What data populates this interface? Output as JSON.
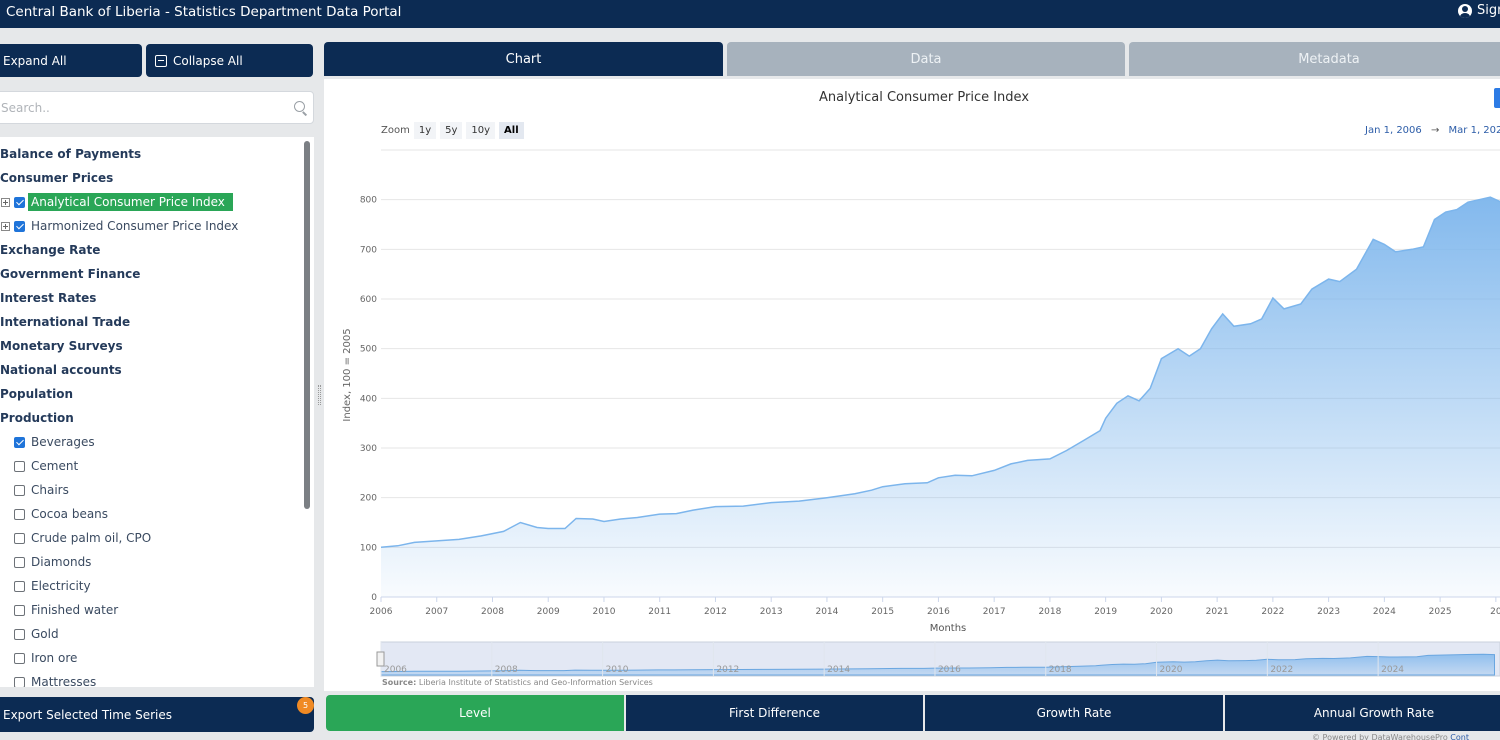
{
  "header": {
    "title": "Central Bank of Liberia - Statistics Department Data Portal",
    "sign_label": "Sign"
  },
  "sidebar": {
    "expand_label": "Expand All",
    "collapse_label": "Collapse All",
    "search_placeholder": "Search..",
    "items": [
      {
        "label": "Balance of Payments"
      },
      {
        "label": "Consumer Prices"
      },
      {
        "label": "Analytical Consumer Price Index"
      },
      {
        "label": "Harmonized Consumer Price Index"
      },
      {
        "label": "Exchange Rate"
      },
      {
        "label": "Government Finance"
      },
      {
        "label": "Interest Rates"
      },
      {
        "label": "International Trade"
      },
      {
        "label": "Monetary Surveys"
      },
      {
        "label": "National accounts"
      },
      {
        "label": "Population"
      },
      {
        "label": "Production"
      },
      {
        "label": "Beverages"
      },
      {
        "label": "Cement"
      },
      {
        "label": "Chairs"
      },
      {
        "label": "Cocoa beans"
      },
      {
        "label": "Crude palm oil, CPO"
      },
      {
        "label": "Diamonds"
      },
      {
        "label": "Electricity"
      },
      {
        "label": "Finished water"
      },
      {
        "label": "Gold"
      },
      {
        "label": "Iron ore"
      },
      {
        "label": "Mattresses"
      }
    ],
    "export_label": "Export Selected Time Series",
    "selected_count": "5"
  },
  "tabs": [
    {
      "label": "Chart"
    },
    {
      "label": "Data"
    },
    {
      "label": "Metadata"
    }
  ],
  "toolbar": {
    "zoom_label": "Zoom",
    "zoom_buttons": [
      {
        "label": "1y"
      },
      {
        "label": "5y"
      },
      {
        "label": "10y"
      },
      {
        "label": "All"
      }
    ],
    "range_from": "Jan 1, 2006",
    "range_arrow": "→",
    "range_to": "Mar 1, 202"
  },
  "chart_data": {
    "type": "area",
    "title": "Analytical Consumer Price Index",
    "xlabel": "Months",
    "ylabel": "Index, 100 = 2005",
    "source_label": "Source:",
    "source_text": "Liberia Institute of Statistics and Geo-Information Services",
    "xlim": [
      2006,
      2026.2
    ],
    "ylim": [
      0,
      900
    ],
    "x_ticks": [
      "2006",
      "2007",
      "2008",
      "2009",
      "2010",
      "2011",
      "2012",
      "2013",
      "2014",
      "2015",
      "2016",
      "2017",
      "2018",
      "2019",
      "2020",
      "2021",
      "2022",
      "2023",
      "2024",
      "2025",
      "20"
    ],
    "y_ticks": [
      "0",
      "100",
      "200",
      "300",
      "400",
      "500",
      "600",
      "700",
      "800"
    ],
    "navigator_labels": [
      "2006",
      "2008",
      "2010",
      "2012",
      "2014",
      "2016",
      "2018",
      "2020",
      "2022",
      "2024"
    ],
    "series": [
      {
        "name": "Analytical Consumer Price Index",
        "color": "#7cb5ec",
        "x": [
          2006.0,
          2006.3,
          2006.6,
          2007.0,
          2007.4,
          2007.8,
          2008.2,
          2008.5,
          2008.8,
          2009.0,
          2009.3,
          2009.5,
          2009.8,
          2010.0,
          2010.3,
          2010.6,
          2011.0,
          2011.3,
          2011.6,
          2012.0,
          2012.5,
          2013.0,
          2013.5,
          2014.0,
          2014.5,
          2014.8,
          2015.0,
          2015.4,
          2015.8,
          2016.0,
          2016.3,
          2016.6,
          2017.0,
          2017.3,
          2017.6,
          2018.0,
          2018.3,
          2018.6,
          2018.9,
          2019.0,
          2019.2,
          2019.4,
          2019.6,
          2019.8,
          2020.0,
          2020.3,
          2020.5,
          2020.7,
          2020.9,
          2021.1,
          2021.3,
          2021.6,
          2021.8,
          2022.0,
          2022.2,
          2022.5,
          2022.7,
          2023.0,
          2023.2,
          2023.5,
          2023.8,
          2024.0,
          2024.2,
          2024.5,
          2024.7,
          2024.9,
          2025.1,
          2025.3,
          2025.5,
          2025.7,
          2025.9,
          2026.1
        ],
        "y": [
          100,
          103,
          110,
          113,
          116,
          123,
          132,
          150,
          140,
          138,
          138,
          158,
          157,
          152,
          157,
          160,
          167,
          168,
          175,
          182,
          183,
          190,
          193,
          200,
          208,
          215,
          222,
          228,
          230,
          240,
          245,
          244,
          255,
          268,
          275,
          278,
          295,
          315,
          335,
          360,
          390,
          405,
          395,
          420,
          480,
          500,
          485,
          500,
          540,
          570,
          545,
          550,
          560,
          602,
          580,
          590,
          620,
          640,
          635,
          660,
          720,
          710,
          695,
          700,
          705,
          760,
          775,
          780,
          795,
          800,
          805,
          795
        ]
      }
    ]
  }
}
